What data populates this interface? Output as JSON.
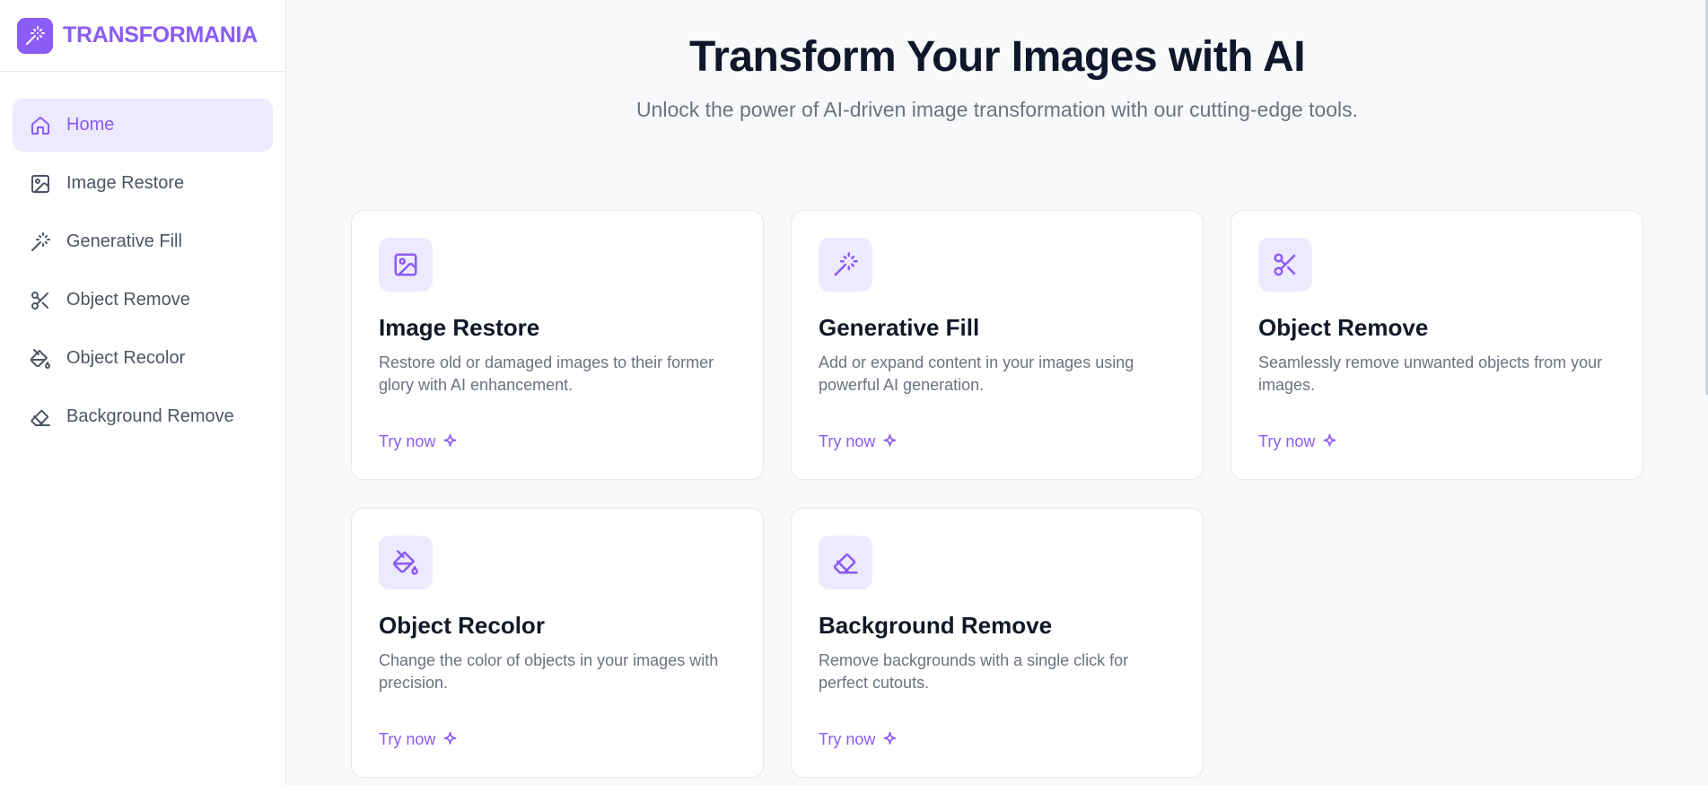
{
  "brand": {
    "name": "TRANSFORMANIA",
    "accent": "#8b5cf6",
    "icon": "magic-wand-icon"
  },
  "sidebar": {
    "items": [
      {
        "label": "Home",
        "icon": "home-icon",
        "active": true
      },
      {
        "label": "Image Restore",
        "icon": "image-icon",
        "active": false
      },
      {
        "label": "Generative Fill",
        "icon": "magic-wand-icon",
        "active": false
      },
      {
        "label": "Object Remove",
        "icon": "scissors-icon",
        "active": false
      },
      {
        "label": "Object Recolor",
        "icon": "paint-bucket-icon",
        "active": false
      },
      {
        "label": "Background Remove",
        "icon": "eraser-icon",
        "active": false
      }
    ]
  },
  "hero": {
    "title": "Transform Your Images with AI",
    "subtitle": "Unlock the power of AI-driven image transformation with our cutting-edge tools."
  },
  "cards": [
    {
      "title": "Image Restore",
      "description": "Restore old or damaged images to their former glory with AI enhancement.",
      "cta": "Try now",
      "icon": "image-icon"
    },
    {
      "title": "Generative Fill",
      "description": "Add or expand content in your images using powerful AI generation.",
      "cta": "Try now",
      "icon": "magic-wand-icon"
    },
    {
      "title": "Object Remove",
      "description": "Seamlessly remove unwanted objects from your images.",
      "cta": "Try now",
      "icon": "scissors-icon"
    },
    {
      "title": "Object Recolor",
      "description": "Change the color of objects in your images with precision.",
      "cta": "Try now",
      "icon": "paint-bucket-icon"
    },
    {
      "title": "Background Remove",
      "description": "Remove backgrounds with a single click for perfect cutouts.",
      "cta": "Try now",
      "icon": "eraser-icon"
    }
  ]
}
